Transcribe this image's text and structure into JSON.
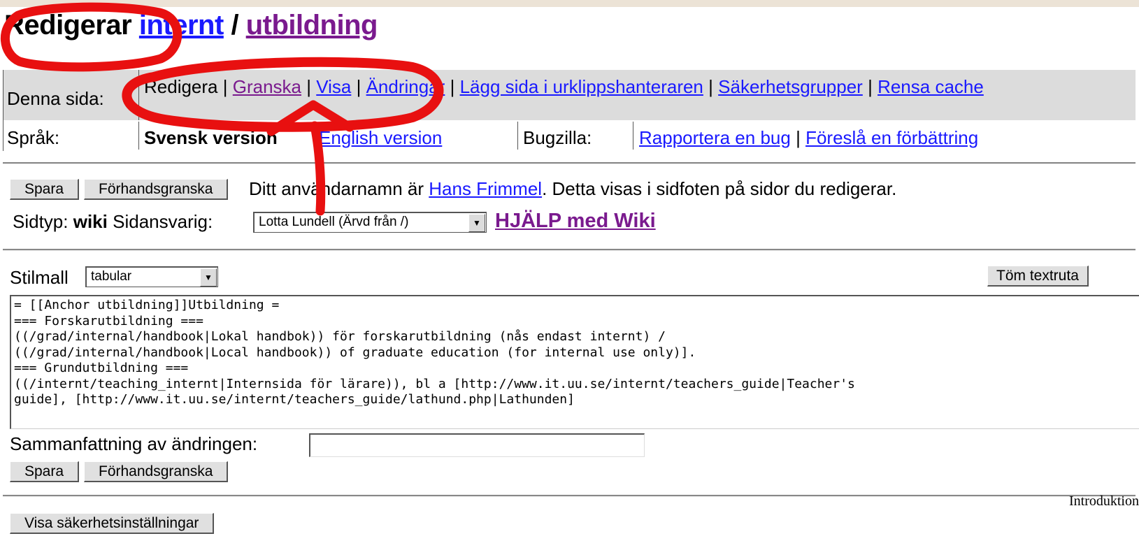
{
  "title": {
    "prefix": "Redigerar",
    "link1": "internt",
    "sep": "/",
    "link2": "utbildning"
  },
  "info": {
    "row1_label": "Denna sida:",
    "actions": [
      {
        "label": "Redigera",
        "kind": "plain"
      },
      {
        "label": "Granska",
        "kind": "visited"
      },
      {
        "label": "Visa",
        "kind": "link"
      },
      {
        "label": "Ändringar",
        "kind": "link"
      },
      {
        "label": "Lägg sida i urklippshanteraren",
        "kind": "link"
      },
      {
        "label": "Säkerhetsgrupper",
        "kind": "link"
      },
      {
        "label": "Rensa cache",
        "kind": "link"
      }
    ],
    "sep": "|",
    "row2_label": "Språk:",
    "svensk": "Svensk version",
    "english": "English version",
    "bugzilla_label": "Bugzilla:",
    "report_bug": "Rapportera en bug",
    "suggest": "Föreslå en förbättring"
  },
  "editor": {
    "save": "Spara",
    "preview": "Förhandsgranska",
    "user_text_prefix": "Ditt användarnamn är",
    "user_name": "Hans Frimmel",
    "user_text_suffix": ". Detta visas i sidfoten på sidor du redigerar.",
    "sidtyp_label": "Sidtyp:",
    "sidtyp_value": "wiki",
    "owner_label": "Sidansvarig:",
    "owner_select": "Lotta Lundell (Ärvd från /)",
    "help": "HJÄLP med Wiki",
    "stilmall_label": "Stilmall",
    "stilmall_select": "tabular",
    "clear": "Töm textruta",
    "content": "= [[Anchor utbildning]]Utbildning =\n=== Forskarutbildning ===\n((/grad/internal/handbook|Lokal handbok)) för forskarutbildning (nås endast internt) /\n((/grad/internal/handbook|Local handbook)) of graduate education (for internal use only)].\n=== Grundutbildning ===\n((/internt/teaching_internt|Internsida för lärare)), bl a [http://www.it.uu.se/internt/teachers_guide|Teacher's\nguide], [http://www.it.uu.se/internt/teachers_guide/lathund.php|Lathunden]",
    "summary_label": "Sammanfattning av ändringen:",
    "summary_value": ""
  },
  "security_button": "Visa säkerhetsinställningar",
  "footer": "Introduktion",
  "annotation": {
    "color": "#e81010"
  }
}
